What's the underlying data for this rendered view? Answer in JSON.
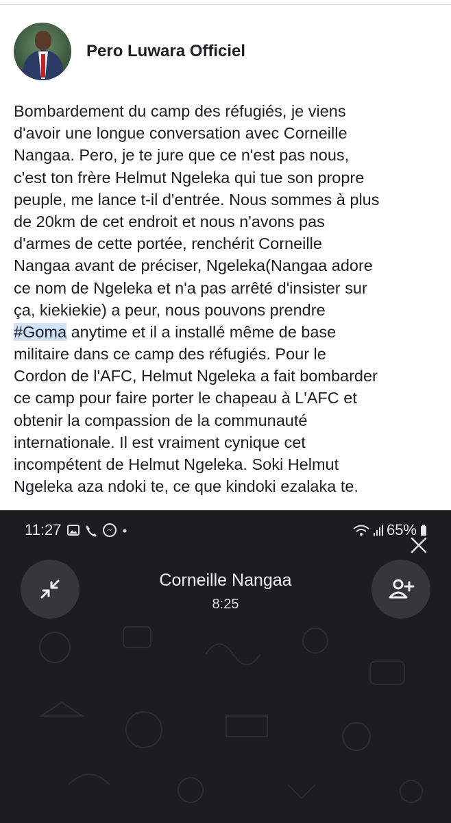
{
  "post": {
    "author": "Pero Luwara Officiel",
    "lines": [
      "Bombardement du camp des réfugiés, je viens",
      "d'avoir une longue conversation avec Corneille",
      "Nangaa. Pero, je te jure que ce n'est pas nous,",
      "c'est ton frère Helmut Ngeleka qui tue son propre",
      "peuple, me lance t-il d'entrée. Nous sommes à plus",
      "de 20km de cet endroit et nous n'avons pas",
      "d'armes de cette portée, renchérit Corneille",
      "Nangaa avant de préciser, Ngeleka(Nangaa adore",
      "ce nom de Ngeleka et n'a pas arrêté d'insister sur",
      "ça,  kiekiekie) a peur, nous pouvons prendre",
      "anytime et il a installé même de base",
      "militaire dans ce camp des réfugiés. Pour le",
      "Cordon de l'AFC, Helmut Ngeleka a fait bombarder",
      "ce camp pour faire porter le chapeau à L'AFC et",
      "obtenir la compassion de la communauté",
      "internationale. Il est vraiment cynique cet",
      "incompétent de Helmut Ngeleka. Soki Helmut",
      "Ngeleka aza ndoki te, ce que kindoki ezalaka te."
    ],
    "hashtag": "#Goma"
  },
  "call_screen": {
    "time": "11:27",
    "battery": "65%",
    "caller_name": "Corneille Nangaa",
    "duration": "8:25",
    "colors": {
      "background": "#1b1d20",
      "button_bg": "#34373b",
      "text": "#ededed"
    }
  },
  "icons": [
    "gallery-icon",
    "phone-icon",
    "messenger-icon",
    "wifi-icon",
    "signal-icon",
    "battery-icon",
    "close-icon",
    "minimize-icon",
    "add-person-icon"
  ]
}
